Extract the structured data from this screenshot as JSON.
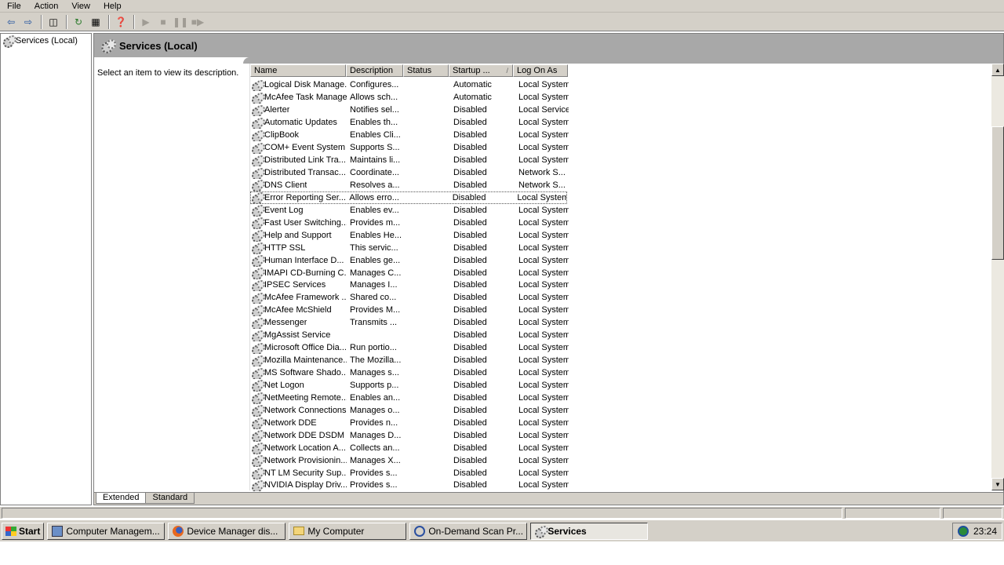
{
  "menu": [
    "File",
    "Action",
    "View",
    "Help"
  ],
  "tree": {
    "root_label": "Services (Local)"
  },
  "header": {
    "title": "Services (Local)"
  },
  "description_text": "Select an item to view its description.",
  "columns": [
    {
      "key": "name",
      "label": "Name",
      "width": 122
    },
    {
      "key": "description",
      "label": "Description",
      "width": 73
    },
    {
      "key": "status",
      "label": "Status",
      "width": 58
    },
    {
      "key": "startup",
      "label": "Startup ...",
      "width": 82
    },
    {
      "key": "logon",
      "label": "Log On As",
      "width": 70
    }
  ],
  "rows": [
    [
      "Logical Disk Manage...",
      "Configures...",
      "",
      "Automatic",
      "Local System"
    ],
    [
      "McAfee Task Manager",
      "Allows sch...",
      "",
      "Automatic",
      "Local System"
    ],
    [
      "Alerter",
      "Notifies sel...",
      "",
      "Disabled",
      "Local Service"
    ],
    [
      "Automatic Updates",
      "Enables th...",
      "",
      "Disabled",
      "Local System"
    ],
    [
      "ClipBook",
      "Enables Cli...",
      "",
      "Disabled",
      "Local System"
    ],
    [
      "COM+ Event System",
      "Supports S...",
      "",
      "Disabled",
      "Local System"
    ],
    [
      "Distributed Link Tra...",
      "Maintains li...",
      "",
      "Disabled",
      "Local System"
    ],
    [
      "Distributed Transac...",
      "Coordinate...",
      "",
      "Disabled",
      "Network S..."
    ],
    [
      "DNS Client",
      "Resolves a...",
      "",
      "Disabled",
      "Network S..."
    ],
    [
      "Error Reporting Ser...",
      "Allows erro...",
      "",
      "Disabled",
      "Local System"
    ],
    [
      "Event Log",
      "Enables ev...",
      "",
      "Disabled",
      "Local System"
    ],
    [
      "Fast User Switching...",
      "Provides m...",
      "",
      "Disabled",
      "Local System"
    ],
    [
      "Help and Support",
      "Enables He...",
      "",
      "Disabled",
      "Local System"
    ],
    [
      "HTTP SSL",
      "This servic...",
      "",
      "Disabled",
      "Local System"
    ],
    [
      "Human Interface D...",
      "Enables ge...",
      "",
      "Disabled",
      "Local System"
    ],
    [
      "IMAPI CD-Burning C...",
      "Manages C...",
      "",
      "Disabled",
      "Local System"
    ],
    [
      "IPSEC Services",
      "Manages I...",
      "",
      "Disabled",
      "Local System"
    ],
    [
      "McAfee Framework ...",
      "Shared co...",
      "",
      "Disabled",
      "Local System"
    ],
    [
      "McAfee McShield",
      "Provides M...",
      "",
      "Disabled",
      "Local System"
    ],
    [
      "Messenger",
      "Transmits ...",
      "",
      "Disabled",
      "Local System"
    ],
    [
      "MgAssist Service",
      "",
      "",
      "Disabled",
      "Local System"
    ],
    [
      "Microsoft Office Dia...",
      "Run portio...",
      "",
      "Disabled",
      "Local System"
    ],
    [
      "Mozilla Maintenance...",
      "The Mozilla...",
      "",
      "Disabled",
      "Local System"
    ],
    [
      "MS Software Shado...",
      "Manages s...",
      "",
      "Disabled",
      "Local System"
    ],
    [
      "Net Logon",
      "Supports p...",
      "",
      "Disabled",
      "Local System"
    ],
    [
      "NetMeeting Remote...",
      "Enables an...",
      "",
      "Disabled",
      "Local System"
    ],
    [
      "Network Connections",
      "Manages o...",
      "",
      "Disabled",
      "Local System"
    ],
    [
      "Network DDE",
      "Provides n...",
      "",
      "Disabled",
      "Local System"
    ],
    [
      "Network DDE DSDM",
      "Manages D...",
      "",
      "Disabled",
      "Local System"
    ],
    [
      "Network Location A...",
      "Collects an...",
      "",
      "Disabled",
      "Local System"
    ],
    [
      "Network Provisionin...",
      "Manages X...",
      "",
      "Disabled",
      "Local System"
    ],
    [
      "NT LM Security Sup...",
      "Provides s...",
      "",
      "Disabled",
      "Local System"
    ],
    [
      "NVIDIA Display Driv...",
      "Provides s...",
      "",
      "Disabled",
      "Local System"
    ]
  ],
  "focused_row": 9,
  "tabs": [
    {
      "label": "Extended",
      "active": true
    },
    {
      "label": "Standard",
      "active": false
    }
  ],
  "taskbar": {
    "start_label": "Start",
    "tasks": [
      {
        "label": "Computer Managem...",
        "icon": "computer-management-icon",
        "active": false
      },
      {
        "label": "Device Manager dis...",
        "icon": "firefox-icon",
        "active": false
      },
      {
        "label": "My Computer",
        "icon": "folder-icon",
        "active": false
      },
      {
        "label": "On-Demand Scan Pr...",
        "icon": "mcafee-scan-icon",
        "active": false
      },
      {
        "label": "Services",
        "icon": "services-gear-icon",
        "active": true
      }
    ],
    "clock": "23:24"
  }
}
